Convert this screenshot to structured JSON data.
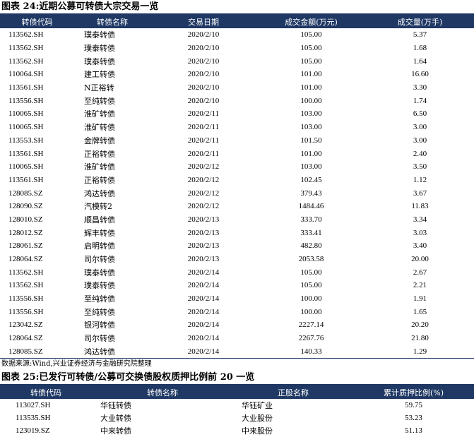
{
  "table1": {
    "title": "图表 24:近期公募可转债大宗交易一览",
    "headers": [
      "转债代码",
      "转债名称",
      "交易日期",
      "成交金额(万元)",
      "成交量(万手)"
    ],
    "rows": [
      [
        "113562.SH",
        "璞泰转债",
        "2020/2/10",
        "105.00",
        "5.37"
      ],
      [
        "113562.SH",
        "璞泰转债",
        "2020/2/10",
        "105.00",
        "1.68"
      ],
      [
        "113562.SH",
        "璞泰转债",
        "2020/2/10",
        "105.00",
        "1.64"
      ],
      [
        "110064.SH",
        "建工转债",
        "2020/2/10",
        "101.00",
        "16.60"
      ],
      [
        "113561.SH",
        "N正裕转",
        "2020/2/10",
        "101.00",
        "3.30"
      ],
      [
        "113556.SH",
        "至纯转债",
        "2020/2/10",
        "100.00",
        "1.74"
      ],
      [
        "110065.SH",
        "淮矿转债",
        "2020/2/11",
        "103.00",
        "6.50"
      ],
      [
        "110065.SH",
        "淮矿转债",
        "2020/2/11",
        "103.00",
        "3.00"
      ],
      [
        "113553.SH",
        "金牌转债",
        "2020/2/11",
        "101.50",
        "3.00"
      ],
      [
        "113561.SH",
        "正裕转债",
        "2020/2/11",
        "101.00",
        "2.40"
      ],
      [
        "110065.SH",
        "淮矿转债",
        "2020/2/12",
        "103.00",
        "3.50"
      ],
      [
        "113561.SH",
        "正裕转债",
        "2020/2/12",
        "102.45",
        "1.12"
      ],
      [
        "128085.SZ",
        "鸿达转债",
        "2020/2/12",
        "379.43",
        "3.67"
      ],
      [
        "128090.SZ",
        "汽模转2",
        "2020/2/12",
        "1484.46",
        "11.83"
      ],
      [
        "128010.SZ",
        "顺昌转债",
        "2020/2/13",
        "333.70",
        "3.34"
      ],
      [
        "128012.SZ",
        "辉丰转债",
        "2020/2/13",
        "333.41",
        "3.03"
      ],
      [
        "128061.SZ",
        "启明转债",
        "2020/2/13",
        "482.80",
        "3.40"
      ],
      [
        "128064.SZ",
        "司尔转债",
        "2020/2/13",
        "2053.58",
        "20.00"
      ],
      [
        "113562.SH",
        "璞泰转债",
        "2020/2/14",
        "105.00",
        "2.67"
      ],
      [
        "113562.SH",
        "璞泰转债",
        "2020/2/14",
        "105.00",
        "2.21"
      ],
      [
        "113556.SH",
        "至纯转债",
        "2020/2/14",
        "100.00",
        "1.91"
      ],
      [
        "113556.SH",
        "至纯转债",
        "2020/2/14",
        "100.00",
        "1.65"
      ],
      [
        "123042.SZ",
        "银河转债",
        "2020/2/14",
        "2227.14",
        "20.20"
      ],
      [
        "128064.SZ",
        "司尔转债",
        "2020/2/14",
        "2267.76",
        "21.80"
      ],
      [
        "128085.SZ",
        "鸿达转债",
        "2020/2/14",
        "140.33",
        "1.29"
      ]
    ],
    "source": "数据来源:Wind,兴业证券经济与金融研究院整理"
  },
  "table2": {
    "title": "图表 25:已发行可转债/公募可交换债股权质押比例前 20 一览",
    "headers": [
      "转债代码",
      "转债名称",
      "正股名称",
      "累计质押比例(%)"
    ],
    "rows": [
      [
        "113027.SH",
        "华钰转债",
        "华钰矿业",
        "59.75"
      ],
      [
        "113535.SH",
        "大业转债",
        "大业股份",
        "53.23"
      ],
      [
        "123019.SZ",
        "中来转债",
        "中来股份",
        "51.13"
      ]
    ]
  },
  "colors": {
    "header_bg": "#1f3864",
    "header_text": "#ffffff"
  }
}
